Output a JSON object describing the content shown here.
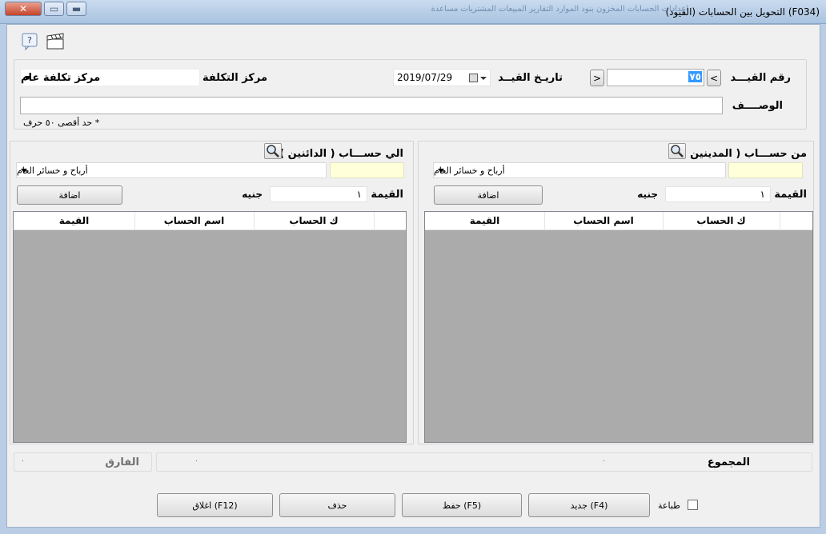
{
  "window": {
    "title": "(F034)  التحويل بين الحسابات (القيود)",
    "menu_ghost": "اعدادات     الحسابات     المخزون     بنود الموارد     التقارير     المبيعات     المشتريات     مساعدة"
  },
  "header": {
    "entry_no_label": "رقم القيـــد",
    "entry_no_value": "٧٥",
    "entry_date_label": "تاريـخ القيــد",
    "entry_date_value": "2019/07/29",
    "cost_center_label": "مركز التكلفة",
    "cost_center_value": "مركز تكلفة عام",
    "desc_label": "الوصــــف",
    "desc_value": "",
    "desc_note": "* حد أقصى ٥٠ حرف",
    "prev_glyph": "<",
    "next_glyph": ">"
  },
  "from_account": {
    "title": "من حســـاب ( المدينين )",
    "account_code": "",
    "account_name": "أرباح و خسائر العام",
    "amount_label": "القيمة",
    "amount_value": "١",
    "currency": "جنيه",
    "add_label": "اضافة",
    "columns": [
      "ك الحساب",
      "اسم الحساب",
      "القيمة"
    ]
  },
  "to_account": {
    "title": "الي حســـاب ( الدائنين )",
    "account_code": "",
    "account_name": "أرباح و خسائر العام",
    "amount_label": "القيمة",
    "amount_value": "١",
    "currency": "جنيه",
    "add_label": "اضافة",
    "columns": [
      "ك الحساب",
      "اسم الحساب",
      "القيمة"
    ]
  },
  "totals": {
    "total_label": "المجموع",
    "diff_label": "الفارق",
    "total_debit": "٠",
    "total_credit": "٠",
    "diff_value": "٠"
  },
  "footer": {
    "print_label": "طباعة",
    "new_label": "جديد (F4)",
    "save_label": "حفظ (F5)",
    "delete_label": "حذف",
    "close_label": "اغلاق (F12)"
  }
}
